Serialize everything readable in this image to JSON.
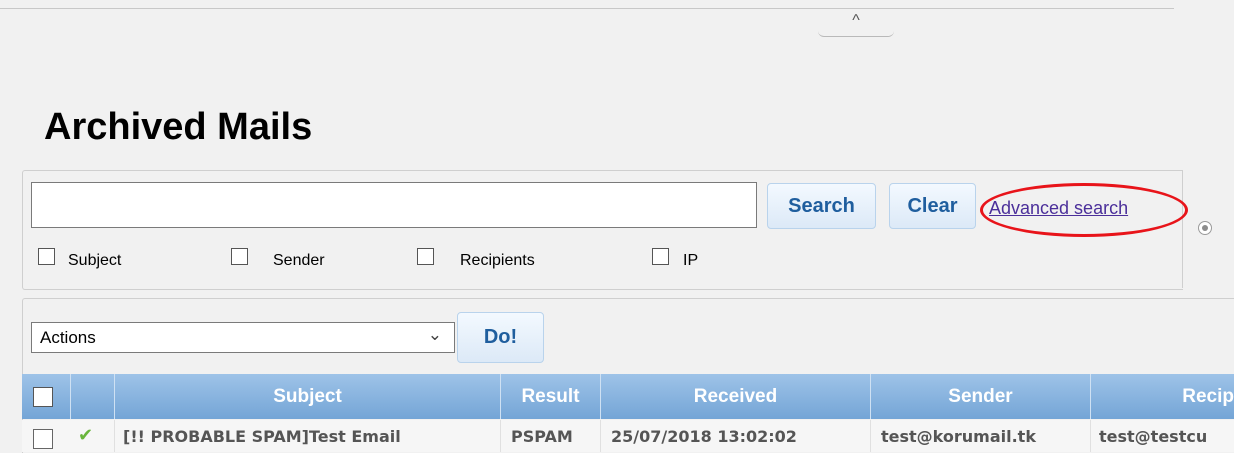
{
  "page": {
    "title": "Archived Mails"
  },
  "collapse": {
    "icon": "chevron-up-icon",
    "glyph": "^"
  },
  "search": {
    "value": "",
    "placeholder": "",
    "search_label": "Search",
    "clear_label": "Clear",
    "advanced_label": "Advanced search",
    "highlight_color": "#e8141a",
    "filters": [
      {
        "label": "Subject"
      },
      {
        "label": "Sender"
      },
      {
        "label": "Recipients"
      },
      {
        "label": "IP"
      }
    ]
  },
  "actions": {
    "selected": "Actions",
    "do_label": "Do!"
  },
  "table": {
    "columns": [
      "Subject",
      "Result",
      "Received",
      "Sender",
      "Recip"
    ],
    "rows": [
      {
        "status_icon": "check-icon",
        "subject": "[!! PROBABLE SPAM]Test Email",
        "result": "PSPAM",
        "received": "25/07/2018 13:02:02",
        "sender": "test@korumail.tk",
        "recipient": "test@testcu"
      }
    ]
  },
  "colors": {
    "accent": "#1f5e9e",
    "header_bg": "#74a5d6",
    "link": "#4b2f9a",
    "check": "#69b53b"
  }
}
